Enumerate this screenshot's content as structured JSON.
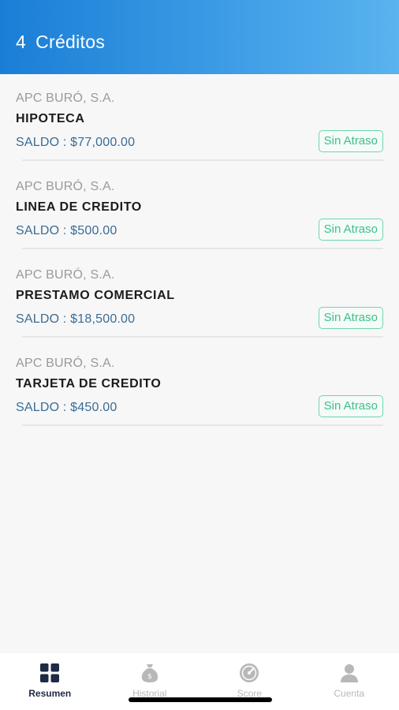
{
  "header": {
    "count": "4",
    "title": "Créditos"
  },
  "credits": [
    {
      "lender": "APC BURÓ, S.A.",
      "product": "HIPOTECA",
      "balance": "SALDO : $77,000.00",
      "status": "Sin Atraso"
    },
    {
      "lender": "APC BURÓ, S.A.",
      "product": "LINEA DE CREDITO",
      "balance": "SALDO : $500.00",
      "status": "Sin Atraso"
    },
    {
      "lender": "APC BURÓ, S.A.",
      "product": "PRESTAMO COMERCIAL",
      "balance": "SALDO : $18,500.00",
      "status": "Sin Atraso"
    },
    {
      "lender": "APC BURÓ, S.A.",
      "product": "TARJETA DE CREDITO",
      "balance": "SALDO : $450.00",
      "status": "Sin Atraso"
    }
  ],
  "tabs": [
    {
      "label": "Resumen",
      "icon": "grid-icon",
      "active": true
    },
    {
      "label": "Historial",
      "icon": "money-bag-icon",
      "active": false
    },
    {
      "label": "Score",
      "icon": "gauge-icon",
      "active": false
    },
    {
      "label": "Cuenta",
      "icon": "user-icon",
      "active": false
    }
  ],
  "colors": {
    "header_start": "#1a7ed6",
    "header_end": "#5ab3ee",
    "balance": "#3a6c93",
    "status": "#3fbf8a",
    "active_tab": "#1f2a44",
    "inactive_tab": "#b8b8b8"
  }
}
